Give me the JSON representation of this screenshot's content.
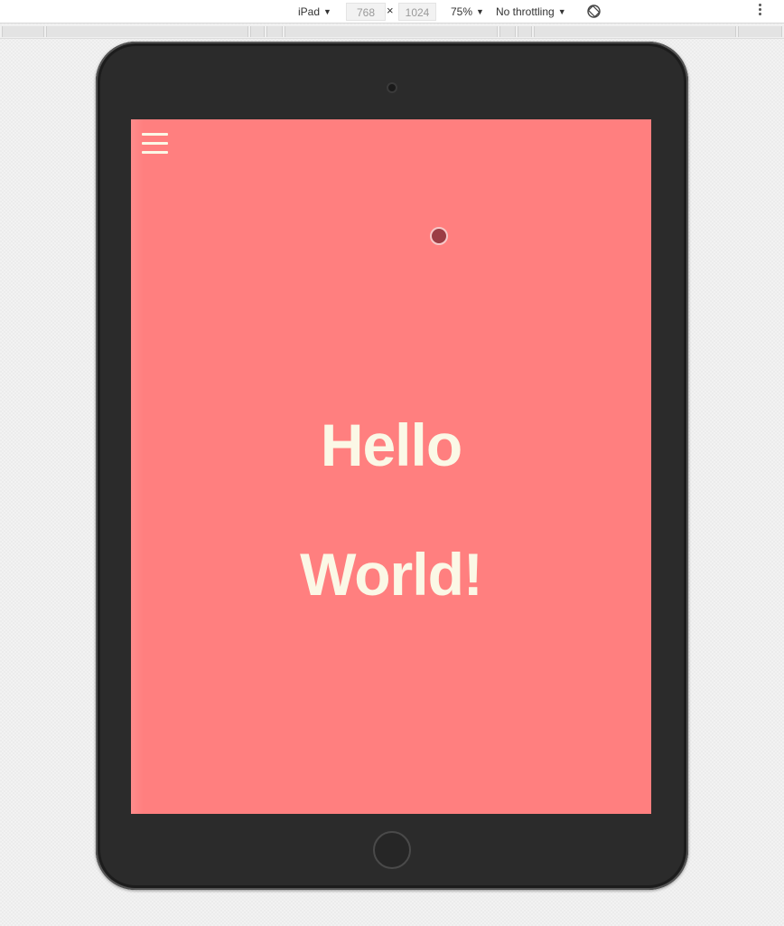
{
  "toolbar": {
    "device": "iPad",
    "width": "768",
    "times": "×",
    "height": "1024",
    "zoom": "75%",
    "throttling": "No throttling"
  },
  "page": {
    "heading_line1": "Hello",
    "heading_line2": "World!",
    "background_color": "#ff7f7f",
    "text_color": "#fbf8e6"
  },
  "icons": {
    "menu": "hamburger-icon",
    "rotate": "rotate-icon",
    "more": "more-vertical-icon"
  }
}
